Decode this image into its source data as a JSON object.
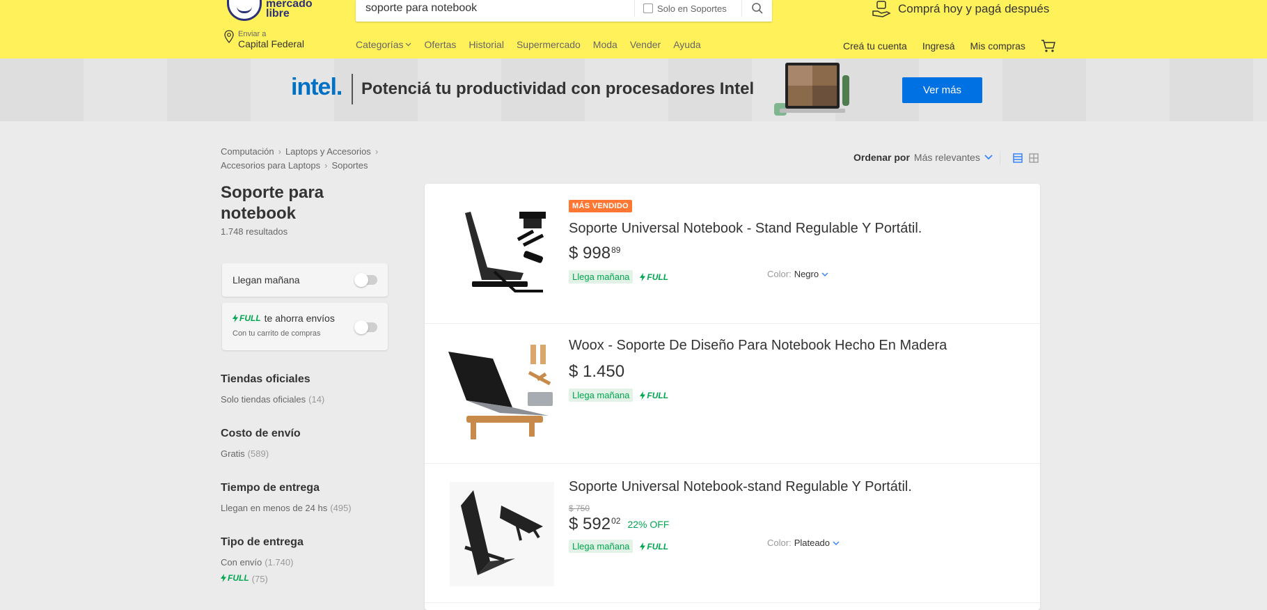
{
  "header": {
    "logo_text_1": "mercado",
    "logo_text_2": "libre",
    "search_value": "soporte para notebook",
    "search_filter_label": "Solo en Soportes",
    "promo_text": "Comprá hoy y pagá después",
    "location_small": "Enviar a",
    "location_big": "Capital Federal",
    "nav": [
      "Categorías",
      "Ofertas",
      "Historial",
      "Supermercado",
      "Moda",
      "Vender",
      "Ayuda"
    ],
    "user_nav": [
      "Creá tu cuenta",
      "Ingresá",
      "Mis compras"
    ]
  },
  "banner": {
    "brand": "intel.",
    "text": "Potenciá tu productividad con procesadores Intel",
    "cta": "Ver más"
  },
  "breadcrumb": [
    "Computación",
    "Laptops y Accesorios",
    "Accesorios para Laptops",
    "Soportes"
  ],
  "page": {
    "title": "Soporte para notebook",
    "results": "1.748 resultados"
  },
  "filters": {
    "tomorrow": "Llegan mañana",
    "full_text": "te ahorra envíos",
    "full_sub": "Con tu carrito de compras",
    "full_label": "FULL"
  },
  "facets": [
    {
      "title": "Tiendas oficiales",
      "items": [
        {
          "label": "Solo tiendas oficiales",
          "count": "(14)"
        }
      ]
    },
    {
      "title": "Costo de envío",
      "items": [
        {
          "label": "Gratis",
          "count": "(589)"
        }
      ]
    },
    {
      "title": "Tiempo de entrega",
      "items": [
        {
          "label": "Llegan en menos de 24 hs",
          "count": "(495)"
        }
      ]
    },
    {
      "title": "Tipo de entrega",
      "items": [
        {
          "label": "Con envío",
          "count": "(1.740)"
        },
        {
          "label": "FULL",
          "count": "(75)"
        }
      ]
    }
  ],
  "sort": {
    "label": "Ordenar por",
    "value": "Más relevantes"
  },
  "items": [
    {
      "badge": "MÁS VENDIDO",
      "title": "Soporte Universal Notebook - Stand Regulable Y Portátil.",
      "currency": "$",
      "price": "998",
      "cents": "89",
      "shipping": "Llega mañana",
      "full": "FULL",
      "color_label": "Color:",
      "color_value": "Negro"
    },
    {
      "title": "Woox - Soporte De Diseño Para Notebook Hecho En Madera",
      "currency": "$",
      "price": "1.450",
      "shipping": "Llega mañana",
      "full": "FULL"
    },
    {
      "title": "Soporte Universal Notebook-stand Regulable Y Portátil.",
      "old_price": "$ 750",
      "currency": "$",
      "price": "592",
      "cents": "02",
      "discount": "22% OFF",
      "shipping": "Llega mañana",
      "full": "FULL",
      "color_label": "Color:",
      "color_value": "Plateado"
    }
  ],
  "colors": {
    "header_bg": "#fff159",
    "full_green": "#00a650",
    "badge_orange": "#ff7733",
    "cta_blue": "#0071e3"
  }
}
